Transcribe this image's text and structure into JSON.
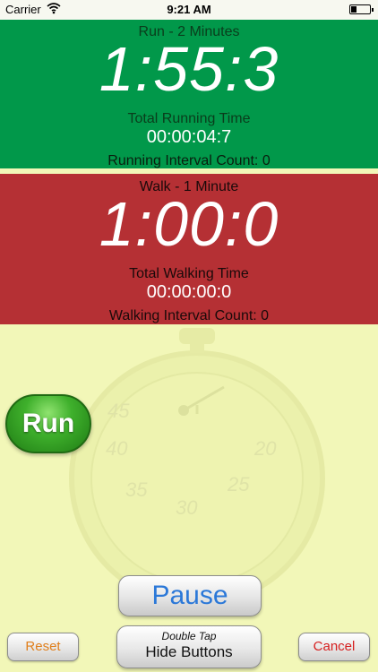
{
  "status_bar": {
    "carrier": "Carrier",
    "time": "9:21 AM"
  },
  "run_panel": {
    "title": "Run - 2 Minutes",
    "countdown": "1:55:3",
    "total_label": "Total Running Time",
    "total_value": "00:00:04:7",
    "count_label": "Running Interval Count: 0",
    "color": "#01984a"
  },
  "walk_panel": {
    "title": "Walk - 1 Minute",
    "countdown": "1:00:0",
    "total_label": "Total Walking Time",
    "total_value": "00:00:00:0",
    "count_label": "Walking Interval Count: 0",
    "color": "#b53034"
  },
  "watermark": {
    "numbers": [
      "45",
      "40",
      "35",
      "30",
      "25",
      "20"
    ]
  },
  "buttons": {
    "run": "Run",
    "pause": "Pause",
    "hide_hint": "Double Tap",
    "hide": "Hide Buttons",
    "reset": "Reset",
    "cancel": "Cancel"
  },
  "colors": {
    "background": "#f2f7b8",
    "pause_text": "#2b78d8",
    "reset_text": "#e07f1c",
    "cancel_text": "#d61f1f"
  }
}
